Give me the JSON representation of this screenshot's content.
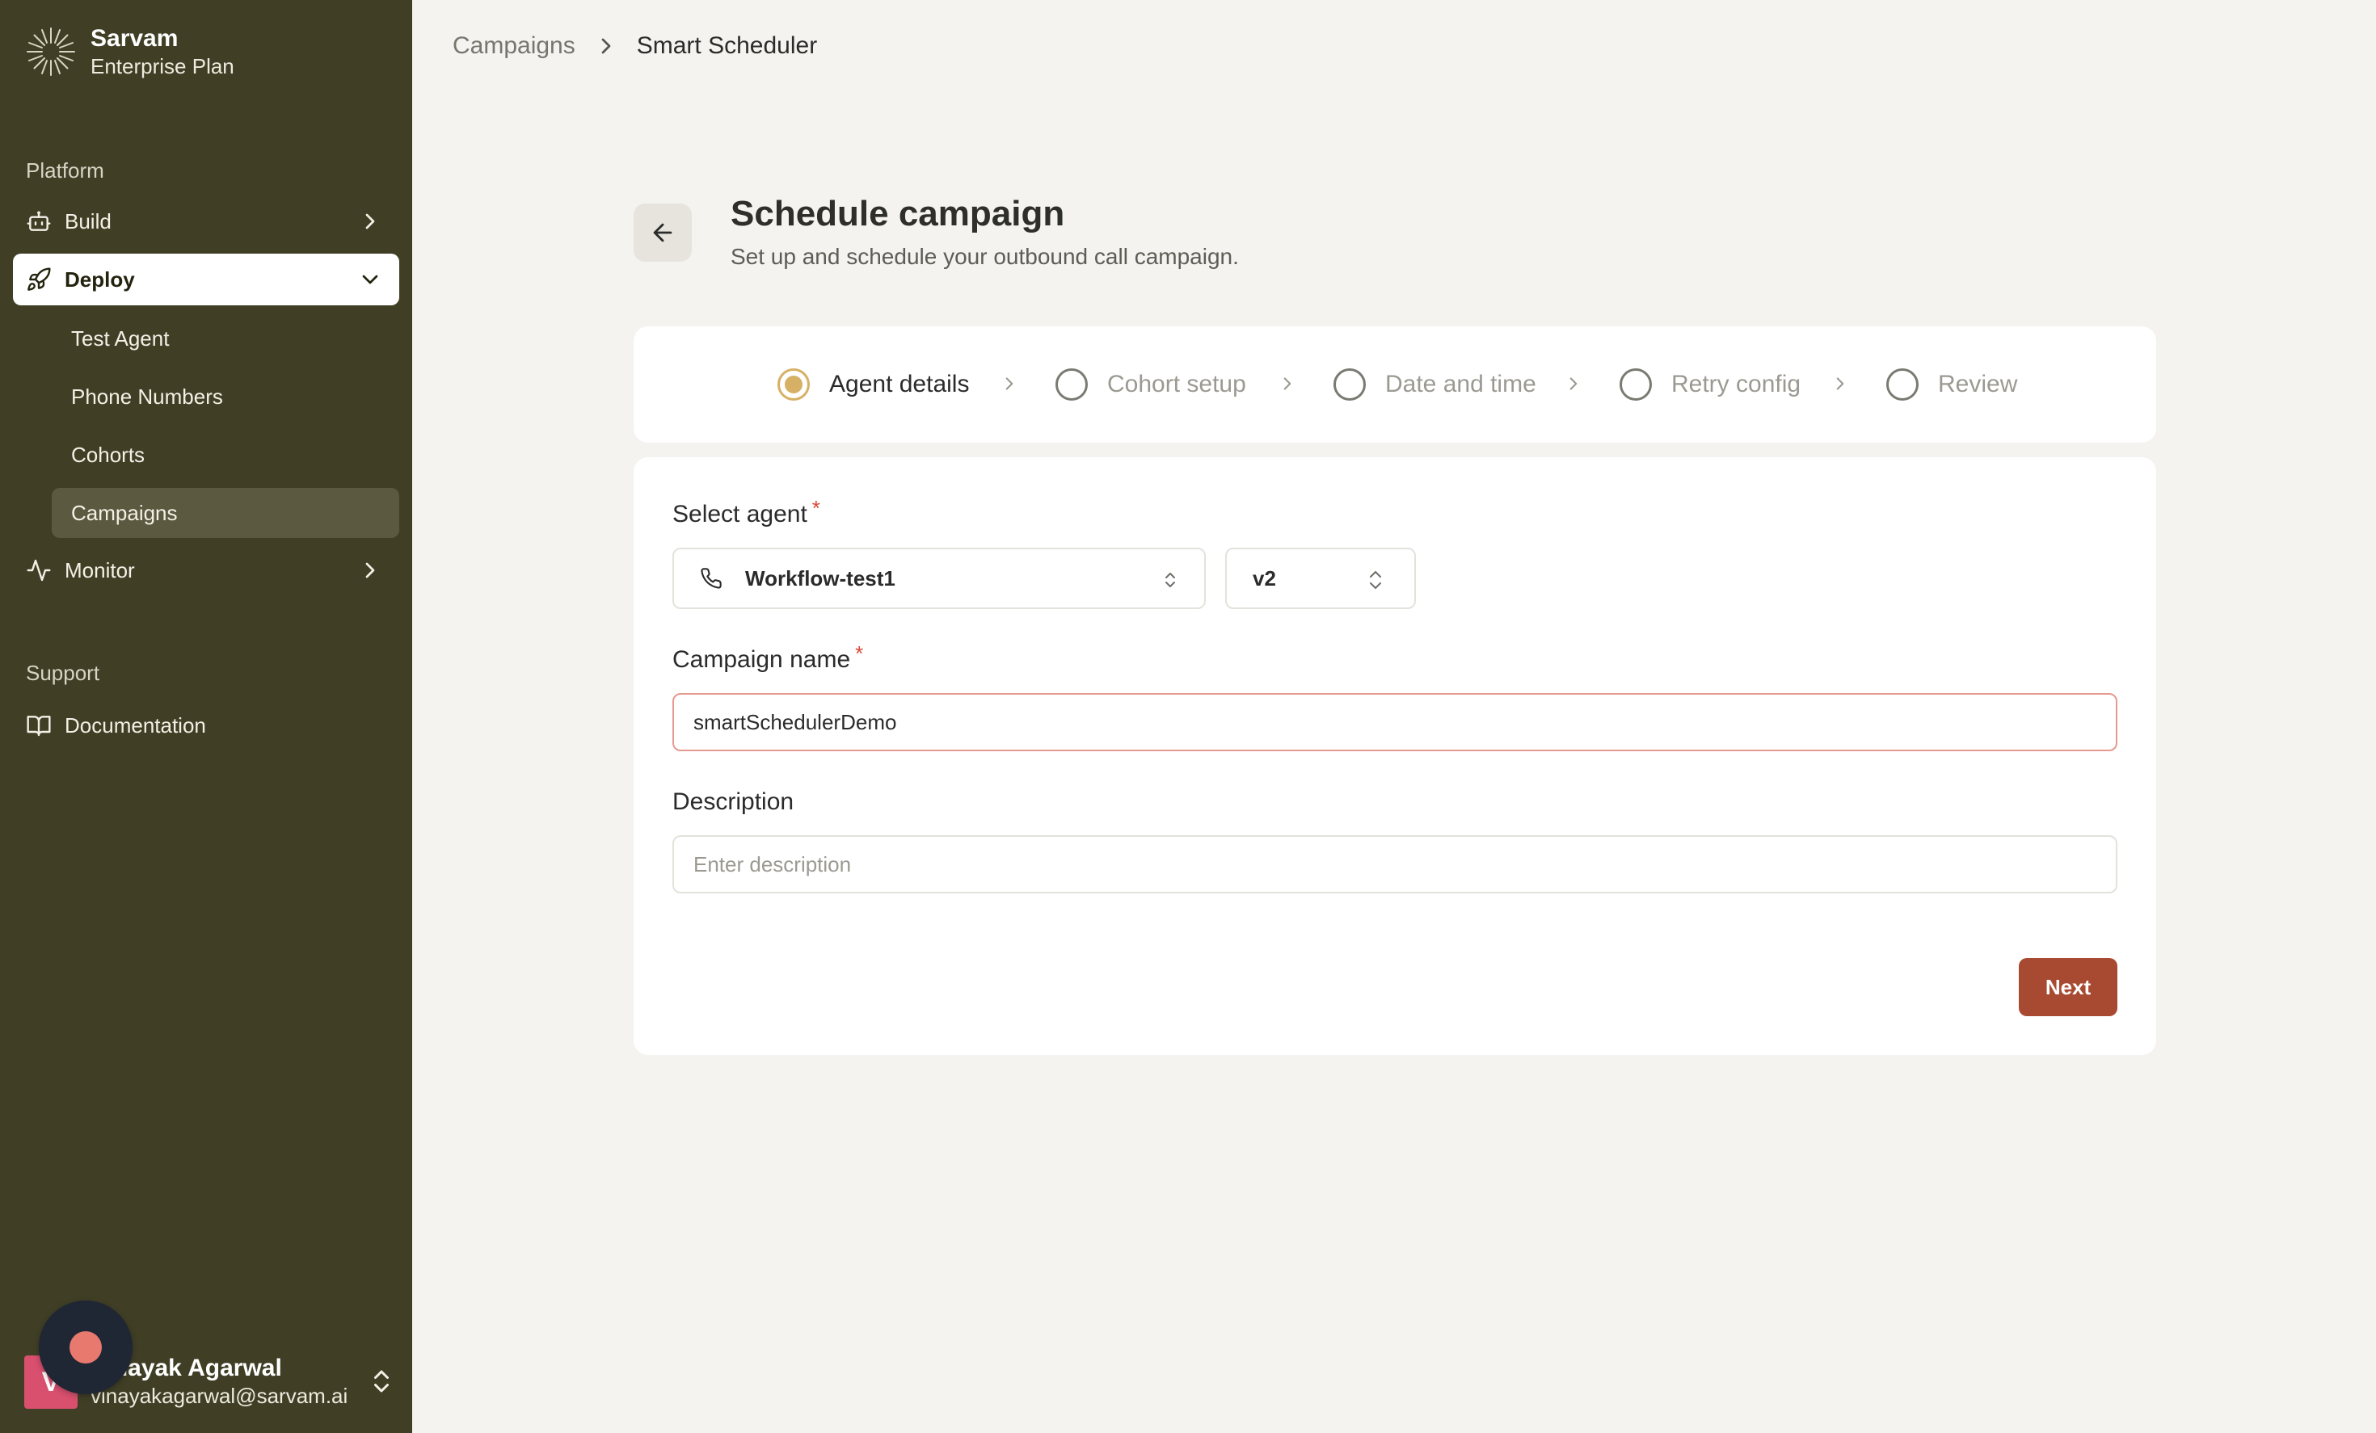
{
  "brand": {
    "name": "Sarvam",
    "plan": "Enterprise Plan"
  },
  "sidebar": {
    "platform_label": "Platform",
    "items": [
      {
        "label": "Build",
        "icon": "bot-icon"
      },
      {
        "label": "Deploy",
        "icon": "rocket-icon",
        "expanded": true
      },
      {
        "label": "Monitor",
        "icon": "activity-icon"
      }
    ],
    "deploy_children": [
      {
        "label": "Test Agent"
      },
      {
        "label": "Phone Numbers"
      },
      {
        "label": "Cohorts"
      },
      {
        "label": "Campaigns",
        "selected": true
      }
    ],
    "support_label": "Support",
    "support_items": [
      {
        "label": "Documentation",
        "icon": "book-icon"
      }
    ]
  },
  "user": {
    "initial": "V",
    "name": "Vinayak Agarwal",
    "email": "vinayakagarwal@sarvam.ai"
  },
  "breadcrumb": {
    "parent": "Campaigns",
    "current": "Smart Scheduler"
  },
  "page": {
    "title": "Schedule campaign",
    "subtitle": "Set up and schedule your outbound call campaign."
  },
  "steps": [
    {
      "label": "Agent details",
      "active": true
    },
    {
      "label": "Cohort setup",
      "active": false
    },
    {
      "label": "Date and time",
      "active": false
    },
    {
      "label": "Retry config",
      "active": false
    },
    {
      "label": "Review",
      "active": false
    }
  ],
  "form": {
    "agent_label": "Select agent",
    "required_mark": "*",
    "agent_value": "Workflow-test1",
    "version_value": "v2",
    "campaign_name_label": "Campaign name",
    "campaign_name_value": "smartSchedulerDemo",
    "description_label": "Description",
    "description_placeholder": "Enter description",
    "next_label": "Next"
  },
  "colors": {
    "sidebar_bg": "#403f26",
    "page_bg": "#f4f3ef",
    "primary_button": "#a84a31",
    "active_step": "#d6b064",
    "required": "#d9483b"
  }
}
